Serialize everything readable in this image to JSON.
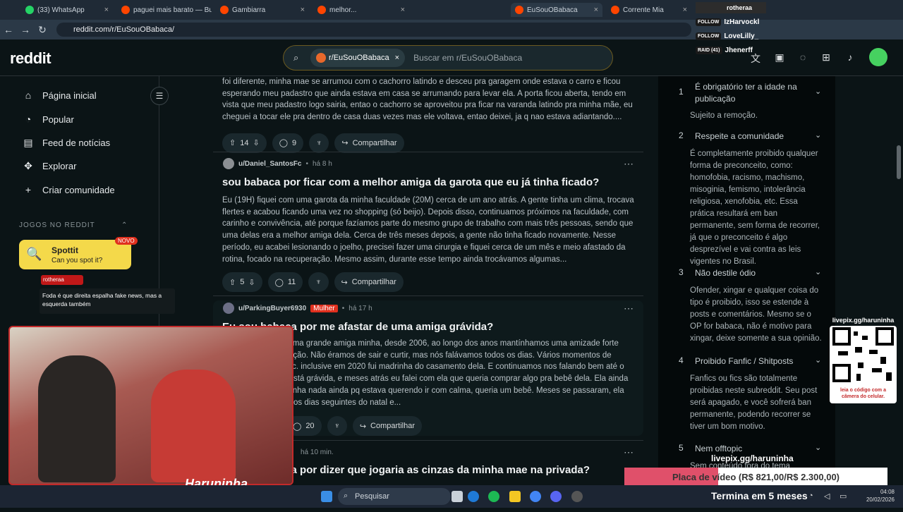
{
  "browser": {
    "tabs": [
      {
        "title": "(33) WhatsApp",
        "icon": "whatsapp-icon",
        "color": "#25d366"
      },
      {
        "title": "paguei mais barato — Bu",
        "icon": "reddit-icon",
        "color": "#ff4500"
      },
      {
        "title": "Gambiarra",
        "icon": "reddit-icon",
        "color": "#ff4500"
      },
      {
        "title": "melhor... ",
        "icon": "reddit-icon",
        "color": "#ff4500"
      },
      {
        "title": "EuSouOBabaca",
        "icon": "reddit-icon",
        "color": "#ff4500",
        "active": true
      },
      {
        "title": "Corrente Mia",
        "icon": "reddit-icon",
        "color": "#ff4500"
      }
    ],
    "url": "reddit.com/r/EuSouOBabaca/"
  },
  "header": {
    "logo": "reddit",
    "search_chip": "r/EuSouOBabaca",
    "search_placeholder": "Buscar em r/EuSouOBabaca"
  },
  "sidebar": {
    "items": [
      {
        "label": "Página inicial",
        "icon": "home-icon"
      },
      {
        "label": "Popular",
        "icon": "popular-icon"
      },
      {
        "label": "Feed de notícias",
        "icon": "news-icon"
      },
      {
        "label": "Explorar",
        "icon": "explore-icon"
      },
      {
        "label": "Criar comunidade",
        "icon": "plus-icon"
      }
    ],
    "games_heading": "JOGOS NO REDDIT",
    "spottit": {
      "title": "Spottit",
      "subtitle": "Can you spot it?",
      "badge": "NOVO"
    }
  },
  "posts": [
    {
      "text": "foi diferente, minha mae se arrumou com o cachorro latindo e desceu pra garagem onde estava o carro e ficou esperando meu padastro que ainda estava em casa se arrumando para levar ela. A porta ficou aberta, tendo em vista que meu padastro logo sairia, entao o cachorro se aproveitou pra ficar na varanda latindo pra minha mãe, eu cheguei a tocar ele pra dentro de casa duas vezes mas ele voltava, entao deixei, ja q nao estava adiantando....",
      "votes": "14",
      "comments": "9",
      "share": "Compartilhar"
    },
    {
      "user": "u/Daniel_SantosFc",
      "time": "há 8 h",
      "title": "sou babaca por ficar com a melhor amiga da garota que eu já tinha ficado?",
      "text": "Eu (19H) fiquei com uma garota da minha faculdade (20M) cerca de um ano atrás. A gente tinha um clima, trocava flertes e acabou ficando uma vez no shopping (só beijo). Depois disso, continuamos próximos na faculdade, com carinho e convivência, até porque fazíamos parte do mesmo grupo de trabalho com mais três pessoas, sendo que uma delas era a melhor amiga dela. Cerca de três meses depois, a gente não tinha ficado novamente. Nesse período, eu acabei lesionando o joelho, precisei fazer uma cirurgia e fiquei cerca de um mês e meio afastado da rotina, focado na recuperação. Mesmo assim, durante esse tempo ainda trocávamos algumas...",
      "votes": "5",
      "comments": "11",
      "share": "Compartilhar"
    },
    {
      "user": "u/ParkingBuyer6930",
      "flair": "Mulher",
      "time": "há 17 h",
      "title": "Eu sou babaca por me afastar de uma amiga grávida?",
      "text": "(M 40) sempre foi uma grande amiga minha, desde 2006, ao longo dos anos mantínhamos uma amizade forte com baixa manutenção. Não éramos de sair e curtir, mas nós falávamos todos os dias. Vários momentos de nossa intimidade etc. inclusive em 2020 fui madrinha do casamento dela. E continuamos nos falando bem até o mês passado. Ela está grávida, e meses atrás eu falei com ela que queria comprar algo pra bebê dela. Ela ainda me disse que não tinha nada ainda pq estava querendo ir com calma, queria um bebê. Meses se passaram, ela fez o chá de bebê nos dias seguintes do natal e...",
      "comments": "20",
      "share": "Compartilhar"
    },
    {
      "time": "há 10 min.",
      "title": "Eu sou babaca por dizer que jogaria as cinzas da minha mae na privada?"
    }
  ],
  "rules": [
    {
      "num": "1",
      "title": "É obrigatório ter a idade na publicação",
      "body": "Sujeito a remoção."
    },
    {
      "num": "2",
      "title": "Respeite a comunidade",
      "body": "É completamente proibido qualquer forma de preconceito, como: homofobia, racismo, machismo, misoginia, femismo, intolerância religiosa, xenofobia, etc. Essa prática resultará em ban permanente, sem forma de recorrer, já que o preconceito é algo desprezível e vai contra as leis vigentes no Brasil."
    },
    {
      "num": "3",
      "title": "Não destile ódio",
      "body": "Ofender, xingar e qualquer coisa do tipo é proibido, isso se estende à posts e comentários. Mesmo se o OP for babaca, não é motivo para xingar, deixe somente a sua opinião."
    },
    {
      "num": "4",
      "title": "Proibido Fanfic / Shitposts",
      "body": "Fanfics ou fics são totalmente proibidas neste subreddit. Seu post será apagado, e você sofrerá ban permanente, podendo recorrer se tiver um bom motivo."
    },
    {
      "num": "5",
      "title": "Nem offtopic",
      "body": "Sem conteúdo fora do tema"
    }
  ],
  "stream": {
    "chat_user": "rotheraa",
    "chat_msg": "Foda é que direita espalha fake news, mas a esquerda também",
    "recent_sub_user": "rotheraa",
    "follows": [
      "IzHarvockl",
      "LoveLilly_"
    ],
    "raid_count": "RAID (41)",
    "raid_user": "Jhenerff",
    "livepix_top": "livepix.gg/haruninha",
    "qr_caption": "leia o código com a câmera do celular.",
    "livepix_bottom": "livepix.gg/haruninha",
    "goal": "Placa de vídeo (R$ 821,00/R$ 2.300,00)",
    "goal_progress": 0.357,
    "timer": "Termina em 5 meses",
    "logo": "Haruninha"
  },
  "taskbar": {
    "search": "Pesquisar",
    "time": "04:08",
    "date": "20/02/2026"
  }
}
